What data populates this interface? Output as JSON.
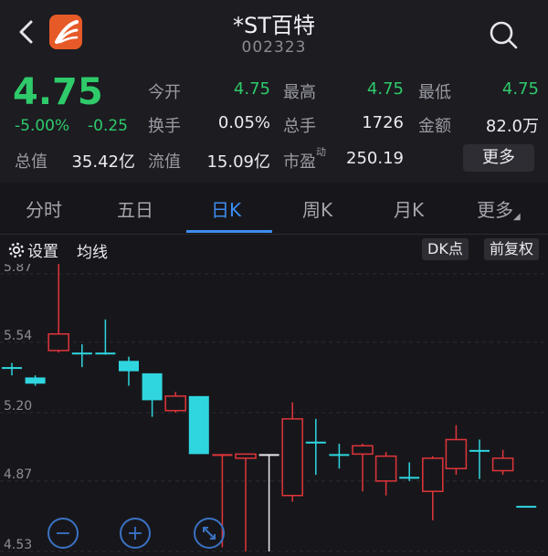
{
  "header": {
    "title": "*ST百特",
    "code": "002323"
  },
  "quote": {
    "price": "4.75",
    "change_pct": "-5.00%",
    "change_amt": "-0.25",
    "stats": [
      {
        "label": "今开",
        "value": "4.75",
        "color": "green"
      },
      {
        "label": "最高",
        "value": "4.75",
        "color": "green"
      },
      {
        "label": "最低",
        "value": "4.75",
        "color": "green"
      },
      {
        "label": "换手",
        "value": "0.05%",
        "color": "white"
      },
      {
        "label": "总手",
        "value": "1726",
        "color": "white"
      },
      {
        "label": "金额",
        "value": "82.0万",
        "color": "white"
      },
      {
        "label": "总值",
        "value": "35.42亿",
        "color": "white"
      },
      {
        "label": "流值",
        "value": "15.09亿",
        "color": "white"
      },
      {
        "label": "市盈",
        "label_sup": "动",
        "value": "250.19",
        "color": "white"
      }
    ],
    "more_label": "更多"
  },
  "tabs": [
    {
      "label": "分时"
    },
    {
      "label": "五日"
    },
    {
      "label": "日K",
      "active": true
    },
    {
      "label": "周K"
    },
    {
      "label": "月K"
    },
    {
      "label": "更多"
    }
  ],
  "toolbar": {
    "settings_label": "设置",
    "ma_label": "均线",
    "dk_label": "DK点",
    "adjust_label": "前复权"
  },
  "colors": {
    "up": "#e0353a",
    "down": "#2fd6e0",
    "flat": "#e8e8ec",
    "accent": "#3d8df0",
    "green": "#2fca6a"
  },
  "chart_data": {
    "type": "candlestick",
    "y_ticks": [
      "5.87",
      "5.54",
      "5.20",
      "4.87",
      "4.53"
    ],
    "ylim": [
      4.53,
      5.95
    ],
    "candles": [
      {
        "open": 5.42,
        "close": 5.42,
        "high": 5.44,
        "low": 5.38
      },
      {
        "open": 5.37,
        "close": 5.34,
        "high": 5.38,
        "low": 5.33
      },
      {
        "open": 5.5,
        "close": 5.58,
        "high": 5.95,
        "low": 5.49
      },
      {
        "open": 5.49,
        "close": 5.49,
        "high": 5.53,
        "low": 5.42
      },
      {
        "open": 5.49,
        "close": 5.49,
        "high": 5.65,
        "low": 5.48
      },
      {
        "open": 5.45,
        "close": 5.4,
        "high": 5.47,
        "low": 5.33
      },
      {
        "open": 5.39,
        "close": 5.26,
        "high": 5.39,
        "low": 5.18
      },
      {
        "open": 5.21,
        "close": 5.28,
        "high": 5.3,
        "low": 5.2
      },
      {
        "open": 5.28,
        "close": 5.0,
        "high": 5.28,
        "low": 5.0
      },
      {
        "open": 5.0,
        "close": 5.0,
        "high": 5.0,
        "low": 4.55
      },
      {
        "open": 4.98,
        "close": 5.0,
        "high": 5.0,
        "low": 4.53
      },
      {
        "open": 5.0,
        "close": 5.0,
        "high": 5.0,
        "low": 4.53
      },
      {
        "open": 4.8,
        "close": 5.17,
        "high": 5.25,
        "low": 4.77
      },
      {
        "open": 5.06,
        "close": 5.06,
        "high": 5.17,
        "low": 4.9
      },
      {
        "open": 5.0,
        "close": 5.0,
        "high": 5.05,
        "low": 4.93
      },
      {
        "open": 5.0,
        "close": 5.04,
        "high": 5.05,
        "low": 4.82
      },
      {
        "open": 4.87,
        "close": 4.99,
        "high": 5.01,
        "low": 4.8
      },
      {
        "open": 4.89,
        "close": 4.89,
        "high": 4.96,
        "low": 4.87
      },
      {
        "open": 4.82,
        "close": 4.98,
        "high": 4.99,
        "low": 4.68
      },
      {
        "open": 4.93,
        "close": 5.07,
        "high": 5.14,
        "low": 4.9
      },
      {
        "open": 5.02,
        "close": 5.02,
        "high": 5.07,
        "low": 4.88
      },
      {
        "open": 4.92,
        "close": 4.98,
        "high": 5.02,
        "low": 4.9
      },
      {
        "open": 4.75,
        "close": 4.75,
        "high": 4.75,
        "low": 4.75
      }
    ]
  }
}
